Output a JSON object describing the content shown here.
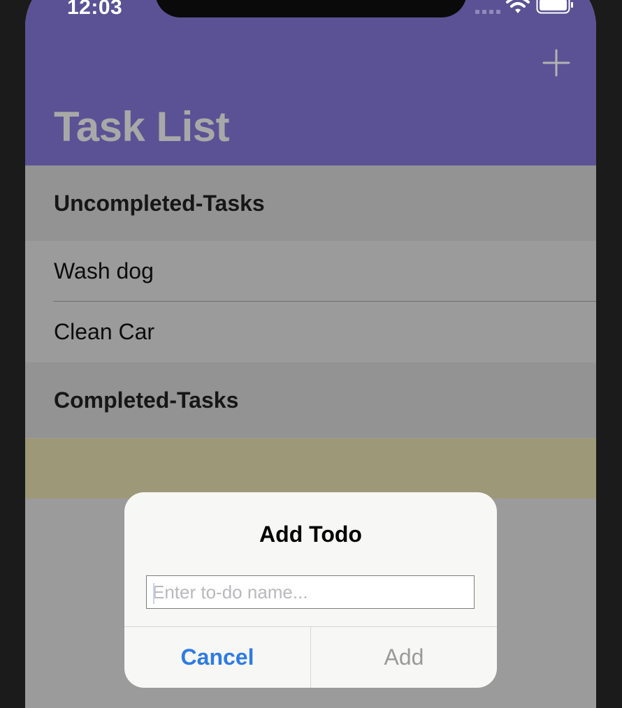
{
  "status_bar": {
    "time": "12:03",
    "icons": [
      "signal-icon",
      "wifi-icon",
      "battery-icon"
    ]
  },
  "nav": {
    "title": "Task List",
    "add_icon": "plus-icon"
  },
  "sections": {
    "uncompleted": {
      "header": "Uncompleted-Tasks",
      "items": [
        "Wash dog",
        "Clean Car"
      ]
    },
    "completed": {
      "header": "Completed-Tasks",
      "items": [
        ""
      ]
    }
  },
  "dialog": {
    "title": "Add Todo",
    "input_value": "",
    "input_placeholder": "Enter to-do name...",
    "cancel_label": "Cancel",
    "add_label": "Add"
  },
  "colors": {
    "nav_background": "#5b5295",
    "accent_blue": "#2f7be3",
    "completed_row": "#9d9878"
  }
}
